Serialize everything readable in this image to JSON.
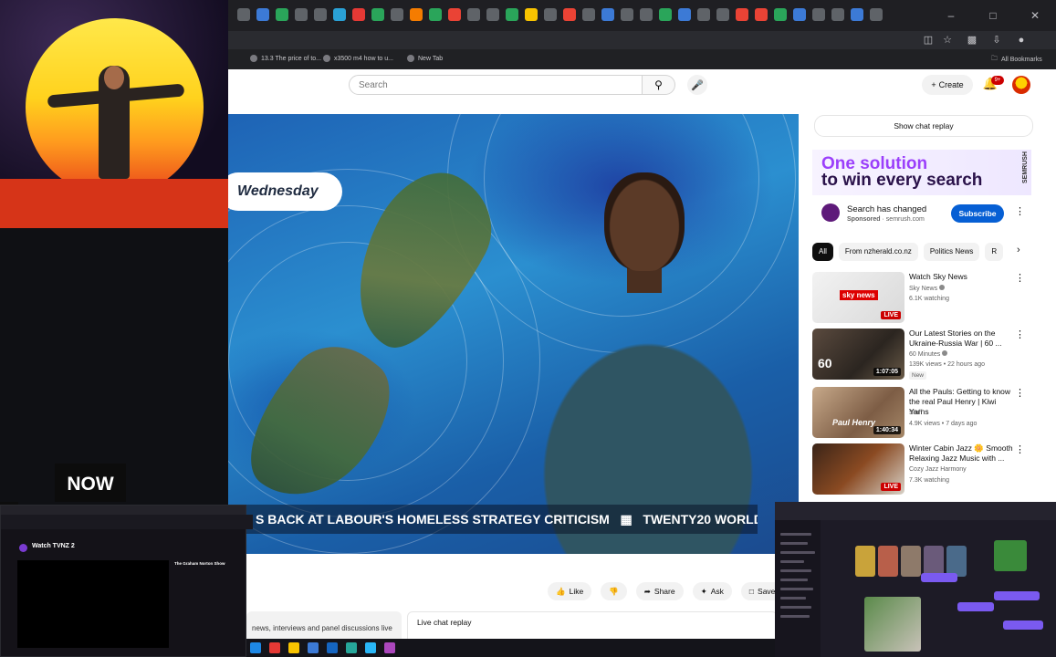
{
  "browser": {
    "tab_favicon_colors": [
      "#5f6368",
      "#3c7ad6",
      "#2aa55a",
      "#5f6368",
      "#5f6368",
      "#2aa1d6",
      "#e53935",
      "#2aa55a",
      "#5f6368",
      "#f57c00",
      "#2aa55a",
      "#ea4335",
      "#5f6368",
      "#5f6368",
      "#2aa55a",
      "#f9c400",
      "#5f6368",
      "#ea4335",
      "#5f6368",
      "#3c7ad6",
      "#5f6368",
      "#5f6368",
      "#2aa55a",
      "#3c7ad6",
      "#5f6368",
      "#5f6368",
      "#ea4335",
      "#ea4335",
      "#2aa55a",
      "#3c7ad6",
      "#5f6368",
      "#5f6368",
      "#3c7ad6",
      "#5f6368"
    ],
    "bookmarks": [
      {
        "label": "13.3 The price of to..."
      },
      {
        "label": "x3500 m4 how to u..."
      },
      {
        "label": "New Tab"
      }
    ],
    "all_bookmarks_label": "All Bookmarks"
  },
  "youtube": {
    "search_placeholder": "Search",
    "create_label": "Create",
    "notifications_badge": "9+",
    "actions": {
      "like": "Like",
      "share": "Share",
      "ask": "Ask",
      "save": "Save"
    },
    "description_snippet": "news, interviews and panel discussions live",
    "live_chat_label": "Live chat replay",
    "show_chat_replay": "Show chat replay",
    "ad": {
      "headline_1": "One solution",
      "headline_2": "to win every search",
      "brand_vertical": "SEMRUSH",
      "title": "Search has changed",
      "sponsored": "Sponsored",
      "domain": "semrush.com",
      "subscribe": "Subscribe"
    },
    "chips": [
      "All",
      "From nzherald.co.nz",
      "Politics News",
      "R"
    ],
    "recommendations": [
      {
        "title": "Watch Sky News",
        "channel": "Sky News",
        "meta": "6.1K watching",
        "badge": "LIVE",
        "thumb_text": "sky news",
        "new": ""
      },
      {
        "title": "Our Latest Stories on the Ukraine-Russia War | 60 ...",
        "channel": "60 Minutes",
        "meta": "139K views • 22 hours ago",
        "badge": "1:07:05",
        "thumb_text": "60",
        "new": "New"
      },
      {
        "title": "All the Pauls: Getting to know the real Paul Henry | Kiwi Yarns",
        "channel": "Stuff",
        "meta": "4.9K views • 7 days ago",
        "badge": "1:40:34",
        "thumb_text": "Paul Henry",
        "new": ""
      },
      {
        "title": "Winter Cabin Jazz 🌼 Smooth Relaxing Jazz Music with ...",
        "channel": "Cozy Jazz Harmony",
        "meta": "7.3K watching",
        "badge": "LIVE",
        "thumb_text": "",
        "new": ""
      }
    ]
  },
  "video": {
    "day_label": "Wednesday",
    "ticker_text": "S BACK AT LABOUR'S HOMELESS STRATEGY CRITICISM",
    "ticker_text_2": "TWENTY20 WORLD",
    "now_logo": "NOW"
  },
  "tvnz_window": {
    "title": "Watch TVNZ 2",
    "side_title": "The Graham Norton Show"
  },
  "colors": {
    "accent_red": "#cc0000",
    "subscribe_blue": "#065fd4",
    "ad_purple": "#9b3ffb"
  }
}
